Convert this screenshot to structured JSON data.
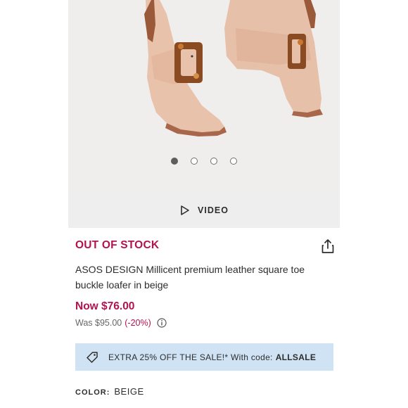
{
  "gallery": {
    "image_alt": "",
    "dots_total": 4,
    "dots_active": 0
  },
  "video": {
    "label": "VIDEO",
    "icon": "play-icon"
  },
  "product": {
    "stock_status": "OUT OF STOCK",
    "title": "ASOS DESIGN Millicent premium leather square toe buckle loafer in beige",
    "price_now": "Now $76.00",
    "price_was": "Was $95.00",
    "discount": "(-20%)",
    "share_icon": "share-icon",
    "info_icon": "info-icon"
  },
  "promo": {
    "text": "EXTRA 25% OFF THE SALE!* With code:",
    "code": "ALLSALE",
    "icon": "tag-icon"
  },
  "color": {
    "label": "COLOR:",
    "value": "BEIGE"
  },
  "colors": {
    "sale_red": "#b3124f",
    "promo_blue": "#cfe3f5",
    "video_bar": "#eeeeee",
    "text": "#2d2d2d"
  }
}
